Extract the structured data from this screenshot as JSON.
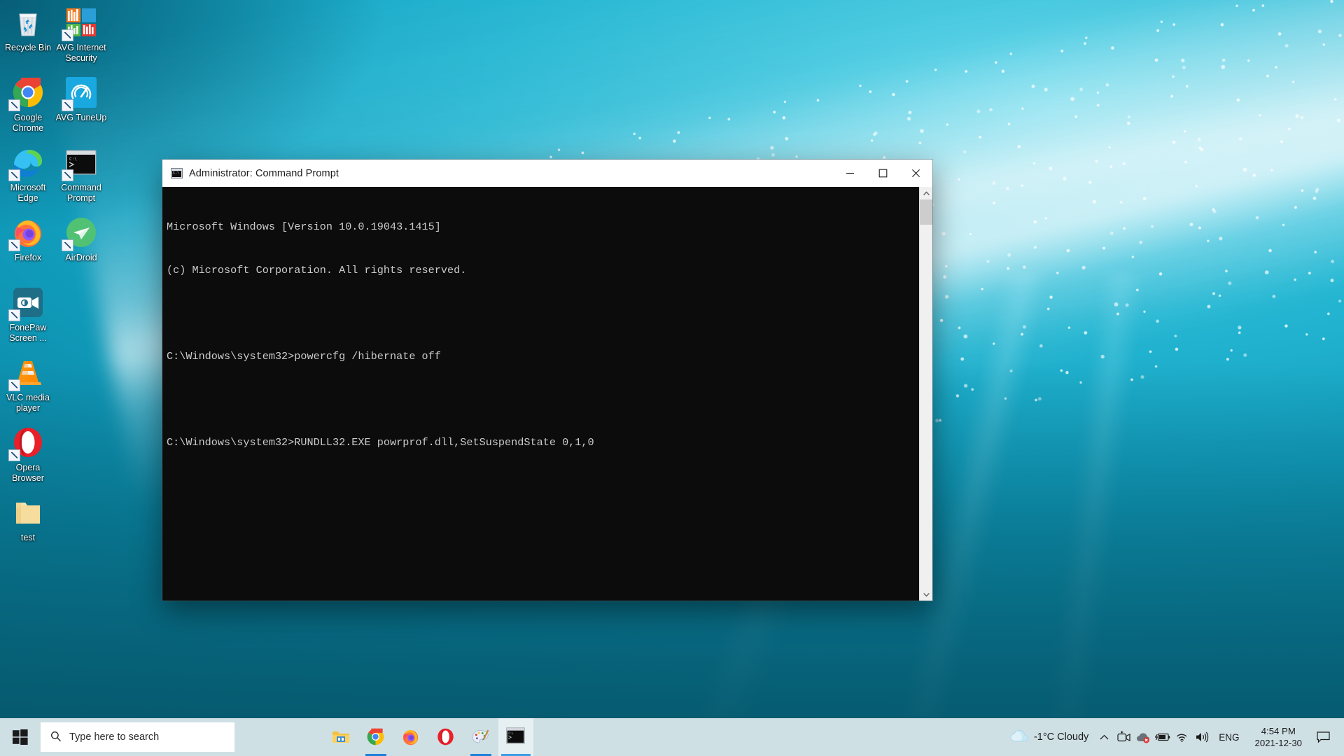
{
  "desktop": {
    "icons": [
      {
        "name": "recycle-bin",
        "label": "Recycle Bin",
        "shortcut": false
      },
      {
        "name": "avg-internet-security",
        "label": "AVG Internet Security",
        "shortcut": true
      },
      {
        "name": "google-chrome",
        "label": "Google Chrome",
        "shortcut": true
      },
      {
        "name": "avg-tuneup",
        "label": "AVG TuneUp",
        "shortcut": true
      },
      {
        "name": "microsoft-edge",
        "label": "Microsoft Edge",
        "shortcut": true
      },
      {
        "name": "command-prompt",
        "label": "Command Prompt",
        "shortcut": true
      },
      {
        "name": "firefox",
        "label": "Firefox",
        "shortcut": true
      },
      {
        "name": "airdroid",
        "label": "AirDroid",
        "shortcut": true
      },
      {
        "name": "fonepaw-screen-recorder",
        "label": "FonePaw Screen ...",
        "shortcut": true
      },
      {
        "name": "vlc-media-player",
        "label": "VLC media player",
        "shortcut": true
      },
      {
        "name": "opera-browser",
        "label": "Opera Browser",
        "shortcut": true
      },
      {
        "name": "test-folder",
        "label": "test",
        "shortcut": false
      }
    ]
  },
  "window": {
    "title": "Administrator: Command Prompt",
    "icon": "console-icon",
    "controls": {
      "minimize": "Minimize",
      "maximize": "Maximize",
      "close": "Close"
    },
    "console": {
      "lines": [
        "Microsoft Windows [Version 10.0.19043.1415]",
        "(c) Microsoft Corporation. All rights reserved.",
        "",
        "C:\\Windows\\system32>powercfg /hibernate off",
        "",
        "C:\\Windows\\system32>RUNDLL32.EXE powrprof.dll,SetSuspendState 0,1,0"
      ],
      "background_color": "#0c0c0c",
      "text_color": "#cccccc"
    },
    "scrollbar": {
      "up_arrow": "scroll-up",
      "down_arrow": "scroll-down",
      "thumb_position_percent": 0
    }
  },
  "taskbar": {
    "start_label": "Start",
    "search": {
      "placeholder": "Type here to search",
      "icon": "search-icon"
    },
    "apps": [
      {
        "name": "file-explorer",
        "label": "File Explorer",
        "active": false,
        "running": false
      },
      {
        "name": "google-chrome",
        "label": "Google Chrome",
        "active": false,
        "running": true
      },
      {
        "name": "firefox",
        "label": "Firefox",
        "active": false,
        "running": false
      },
      {
        "name": "opera",
        "label": "Opera",
        "active": false,
        "running": false
      },
      {
        "name": "paint",
        "label": "Paint",
        "active": false,
        "running": true
      },
      {
        "name": "command-prompt",
        "label": "Command Prompt",
        "active": true,
        "running": true
      }
    ],
    "tray": {
      "weather": {
        "temperature": "-1°C",
        "condition": "Cloudy",
        "text": "-1°C  Cloudy",
        "icon": "cloud-icon"
      },
      "overflow_icon": "chevron-up-icon",
      "icons": [
        {
          "name": "screen-recorder-icon",
          "label": "FonePaw Screen Recorder"
        },
        {
          "name": "avg-cloud-alert-icon",
          "label": "AVG"
        },
        {
          "name": "battery-charging-icon",
          "label": "Battery"
        },
        {
          "name": "wifi-icon",
          "label": "Network"
        },
        {
          "name": "volume-icon",
          "label": "Speakers"
        }
      ],
      "language": "ENG",
      "clock": {
        "time": "4:54 PM",
        "date": "2021-12-30"
      },
      "notification_icon": "notification-icon",
      "show_desktop": "Show desktop"
    }
  },
  "colors": {
    "taskbar_bg": "#cfe0e5",
    "accent_blue": "#1f82d9",
    "console_bg": "#0c0c0c",
    "wallpaper_deep": "#07697f",
    "wallpaper_light": "#4fd2e8"
  }
}
